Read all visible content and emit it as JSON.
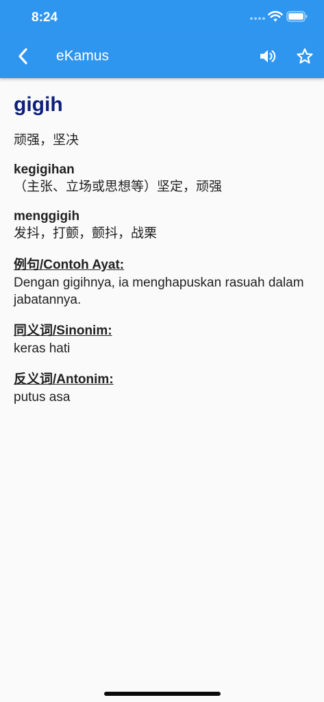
{
  "status_bar": {
    "time": "8:24",
    "background": "#2f96f0"
  },
  "app_bar": {
    "title": "eKamus",
    "back_icon": "chevron-left-icon",
    "speaker_icon": "speaker-icon",
    "favorite_icon": "star-outline-icon"
  },
  "entry": {
    "headword": "gigih",
    "meaning": "顽强，坚决",
    "derivatives": [
      {
        "term": "kegigihan",
        "meaning": "（主张、立场或思想等）坚定，顽强"
      },
      {
        "term": "menggigih",
        "meaning": "发抖，打颤，颤抖，战栗"
      }
    ],
    "example": {
      "heading": "例句/Contoh Ayat:",
      "text": "Dengan gigihnya, ia menghapuskan rasuah dalam jabatannya."
    },
    "synonym": {
      "heading": "同义词/Sinonim:",
      "text": "keras hati"
    },
    "antonym": {
      "heading": "反义词/Antonim:",
      "text": "putus asa"
    }
  },
  "colors": {
    "accent": "#2f96f0",
    "headword": "#0d1f7a",
    "text": "#212121",
    "background": "#fafafa"
  }
}
